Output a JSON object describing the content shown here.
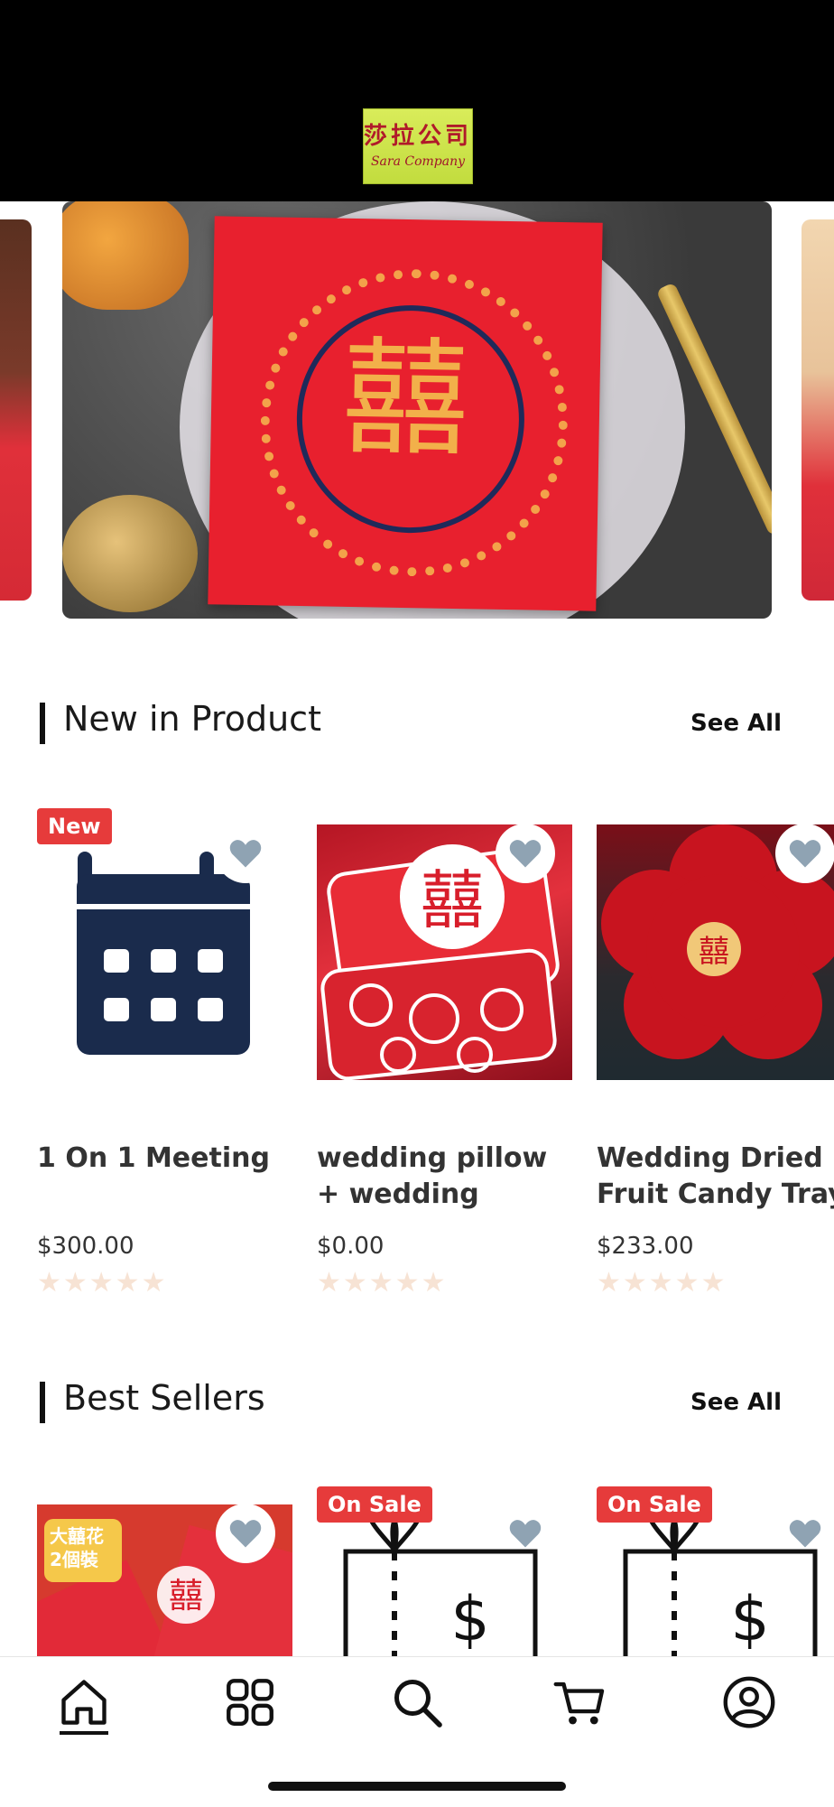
{
  "header": {
    "logo_text_cn": "莎拉公司",
    "logo_text_en": "Sara Company"
  },
  "banner": {
    "symbol": "囍"
  },
  "new_in_product": {
    "title": "New in Product",
    "see_all": "See All",
    "items": [
      {
        "name": "1 On 1 Meeting",
        "name_line2": "",
        "price": "$300.00",
        "badge": "New",
        "stars": "★★★★★"
      },
      {
        "name": "wedding pillow",
        "name_line2": "+ wedding",
        "price": "$0.00",
        "badge": "",
        "stars": "★★★★★"
      },
      {
        "name": "Wedding Dried",
        "name_line2": "Fruit Candy Tray",
        "price": "$233.00",
        "badge": "",
        "stars": "★★★★★"
      }
    ]
  },
  "best_sellers": {
    "title": "Best Sellers",
    "see_all": "See All",
    "items": [
      {
        "badge": "",
        "thumb_text": "大囍花",
        "thumb_text2": "2個裝"
      },
      {
        "badge": "On Sale"
      },
      {
        "badge": "On Sale"
      }
    ]
  },
  "colors": {
    "accent": "#e63b3b",
    "primary_dark": "#1a2b4c",
    "heart": "#8fa3b3"
  },
  "tabbar": {
    "items": [
      "home-icon",
      "categories-icon",
      "search-icon",
      "cart-icon",
      "profile-icon"
    ]
  }
}
